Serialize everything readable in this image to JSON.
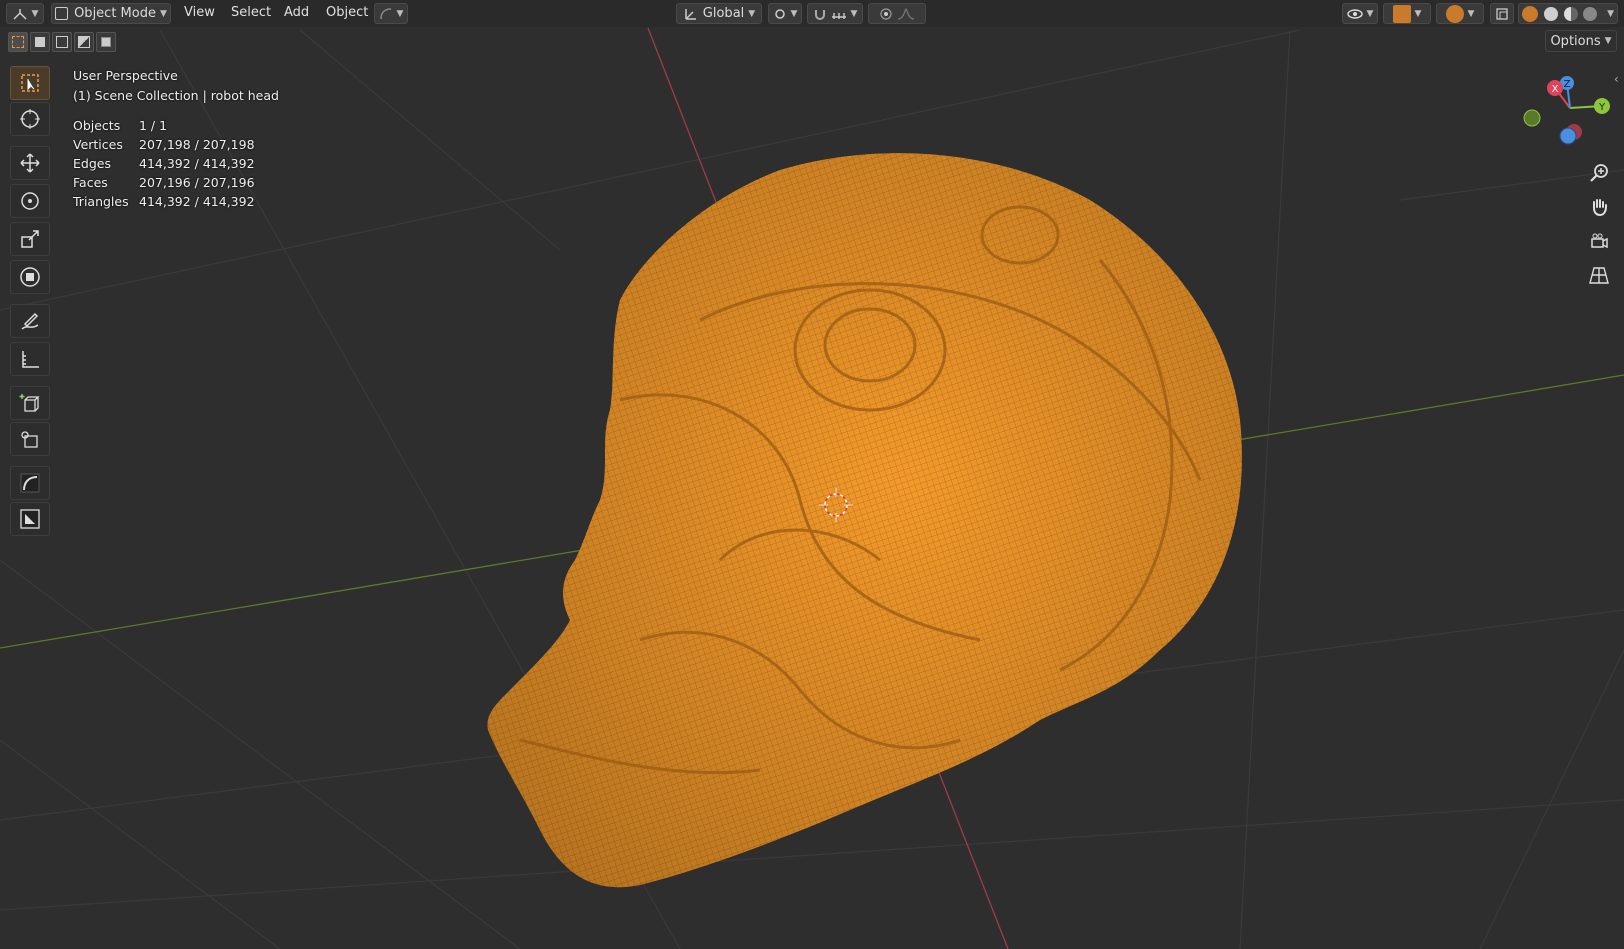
{
  "header": {
    "mode_label": "Object Mode",
    "menus": [
      "View",
      "Select",
      "Add",
      "Object"
    ],
    "transform_orientation": "Global",
    "options_label": "Options"
  },
  "overlay": {
    "perspective": "User Perspective",
    "collection": "(1) Scene Collection | robot head"
  },
  "stats": [
    {
      "label": "Objects",
      "value": "1 / 1"
    },
    {
      "label": "Vertices",
      "value": "207,198 / 207,198"
    },
    {
      "label": "Edges",
      "value": "414,392 / 414,392"
    },
    {
      "label": "Faces",
      "value": "207,196 / 207,196"
    },
    {
      "label": "Triangles",
      "value": "414,392 / 414,392"
    }
  ],
  "gizmo": {
    "x_label": "X",
    "y_label": "Y",
    "z_label": "Z"
  },
  "colors": {
    "mesh_orange": "#f39a2b",
    "x_axis_red": "#e0445a",
    "y_axis_green": "#8cc63f",
    "z_axis_blue": "#4a8fe0",
    "active_tool": "#c97a2a"
  },
  "tools": [
    "select-box-icon",
    "cursor-icon",
    "move-icon",
    "rotate-icon",
    "scale-icon",
    "transform-icon",
    "annotate-icon",
    "measure-icon",
    "add-cube-icon",
    "extrude-icon",
    "curve-icon",
    "sample-icon"
  ]
}
